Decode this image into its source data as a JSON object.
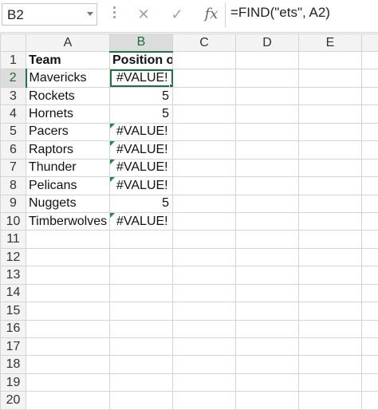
{
  "name_box": "B2",
  "formula": "=FIND(\"ets\", A2)",
  "fx_symbol": "fx",
  "icons": {
    "cancel": "✕",
    "enter": "✓"
  },
  "columns": [
    "A",
    "B",
    "C",
    "D",
    "E"
  ],
  "rows": [
    {
      "n": "1",
      "a": "Team",
      "b": "Position of \"ets\""
    },
    {
      "n": "2",
      "a": "Mavericks",
      "b": "#VALUE!"
    },
    {
      "n": "3",
      "a": "Rockets",
      "b": "5"
    },
    {
      "n": "4",
      "a": "Hornets",
      "b": "5"
    },
    {
      "n": "5",
      "a": "Pacers",
      "b": "#VALUE!"
    },
    {
      "n": "6",
      "a": "Raptors",
      "b": "#VALUE!"
    },
    {
      "n": "7",
      "a": "Thunder",
      "b": "#VALUE!"
    },
    {
      "n": "8",
      "a": "Pelicans",
      "b": "#VALUE!"
    },
    {
      "n": "9",
      "a": "Nuggets",
      "b": "5"
    },
    {
      "n": "10",
      "a": "Timberwolves",
      "b": "#VALUE!"
    },
    {
      "n": "11",
      "a": "",
      "b": ""
    },
    {
      "n": "12",
      "a": "",
      "b": ""
    },
    {
      "n": "13",
      "a": "",
      "b": ""
    },
    {
      "n": "14",
      "a": "",
      "b": ""
    },
    {
      "n": "15",
      "a": "",
      "b": ""
    },
    {
      "n": "16",
      "a": "",
      "b": ""
    },
    {
      "n": "17",
      "a": "",
      "b": ""
    },
    {
      "n": "18",
      "a": "",
      "b": ""
    },
    {
      "n": "19",
      "a": "",
      "b": ""
    },
    {
      "n": "20",
      "a": "",
      "b": ""
    }
  ],
  "colors": {
    "accent": "#217346",
    "error_indicator": "#1f8a3b"
  }
}
